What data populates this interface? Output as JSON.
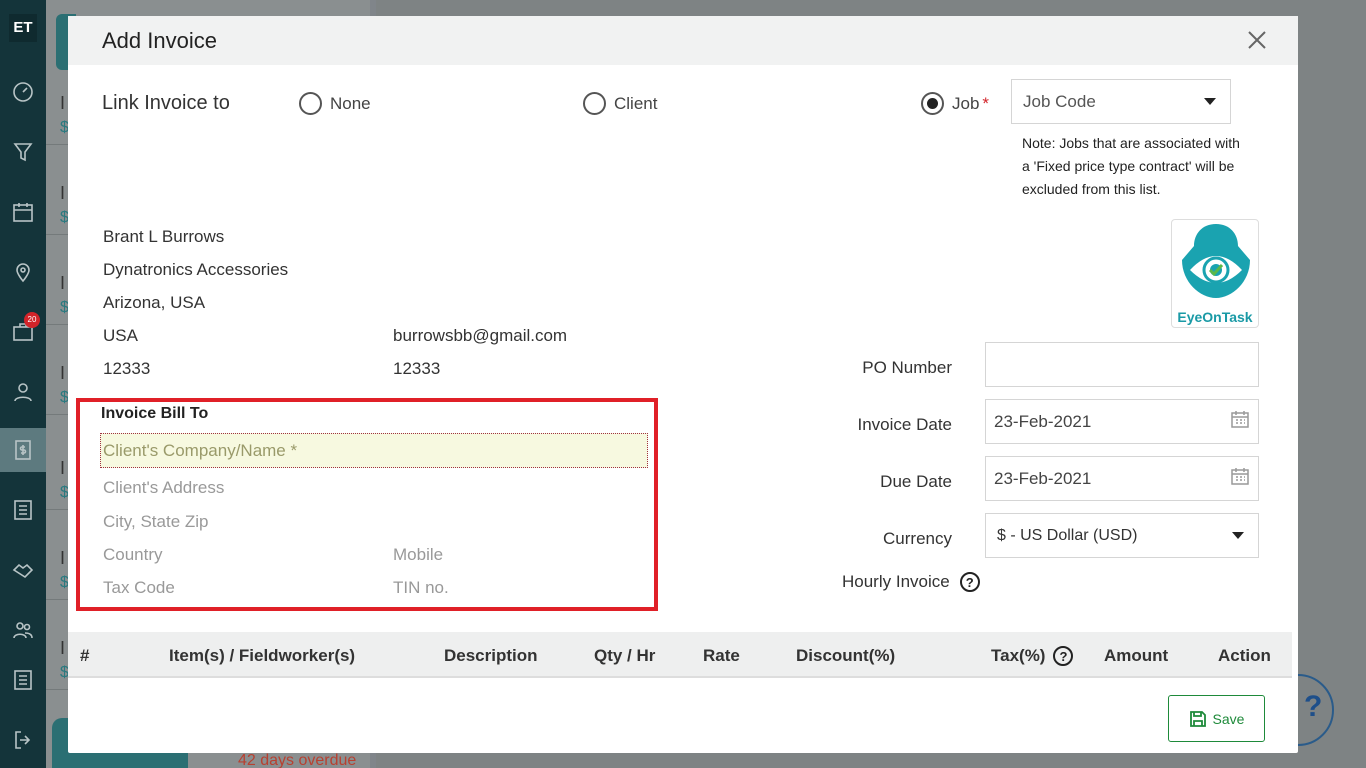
{
  "app": {
    "logo_text": "ET",
    "sidebar_badge": "20"
  },
  "background": {
    "rows": [
      "I",
      "I",
      "I",
      "I",
      "I",
      "I",
      "I",
      "I"
    ],
    "row_sub": "$",
    "overdue_text": "42 days overdue",
    "help_glyph": "?"
  },
  "modal": {
    "title": "Add Invoice",
    "link_invoice_to": "Link Invoice to",
    "radio_none": "None",
    "radio_client": "Client",
    "radio_job": "Job",
    "required_mark": "*",
    "job_code_placeholder": "Job Code",
    "note": "Note: Jobs that are associated with a 'Fixed price type contract' will be excluded from this list.",
    "logo_text": "EyeOnTask"
  },
  "client_info": {
    "name": "Brant L Burrows",
    "company": "Dynatronics Accessories",
    "location": "Arizona, USA",
    "country": "USA",
    "email": "burrowsbb@gmail.com",
    "zip": "12333",
    "mobile": "12333"
  },
  "bill_to": {
    "title": "Invoice Bill To",
    "company_placeholder": "Client's Company/Name *",
    "address_placeholder": "Client's Address",
    "city_placeholder": "City, State Zip",
    "country_placeholder": "Country",
    "mobile_placeholder": "Mobile",
    "tax_placeholder": "Tax Code",
    "tin_placeholder": "TIN no."
  },
  "fields": {
    "po_label": "PO Number",
    "po_value": "",
    "invoice_date_label": "Invoice Date",
    "invoice_date": "23-Feb-2021",
    "due_date_label": "Due Date",
    "due_date": "23-Feb-2021",
    "currency_label": "Currency",
    "currency": "$ - US Dollar (USD)",
    "hourly_label": "Hourly Invoice"
  },
  "table": {
    "headers": [
      "#",
      "Item(s) / Fieldworker(s)",
      "Description",
      "Qty / Hr",
      "Rate",
      "Discount(%)",
      "Tax(%)",
      "Amount",
      "Action"
    ]
  },
  "buttons": {
    "save": "Save"
  },
  "colors": {
    "highlight_border": "#e02028",
    "accent": "#2b6f73",
    "save_green": "#1e8a3a"
  }
}
